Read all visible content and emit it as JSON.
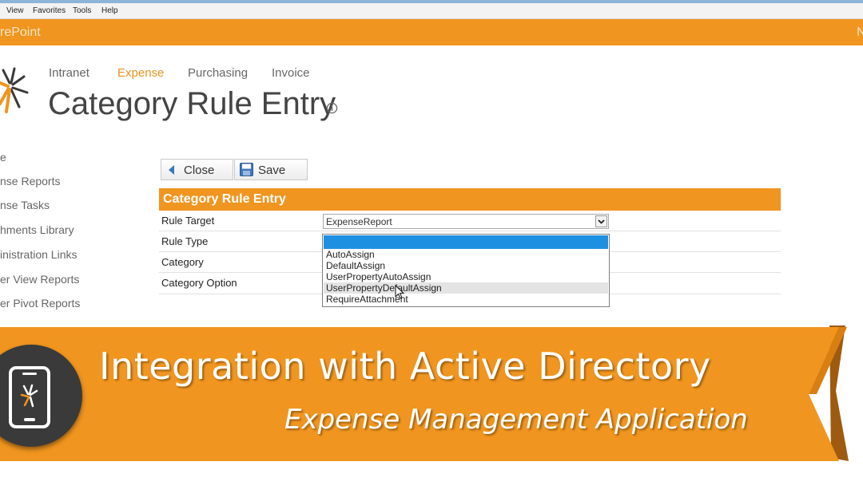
{
  "browser_menu": [
    "View",
    "Favorites",
    "Tools",
    "Help"
  ],
  "suite_bar": {
    "brand": "rePoint",
    "right_text": "N"
  },
  "top_nav": [
    {
      "label": "Intranet",
      "active": false
    },
    {
      "label": "Expense",
      "active": true
    },
    {
      "label": "Purchasing",
      "active": false
    },
    {
      "label": "Invoice",
      "active": false
    }
  ],
  "page": {
    "title": "Category Rule Entry",
    "info_icon": "info-circle-icon"
  },
  "left_nav": [
    "e",
    "nse Reports",
    "nse Tasks",
    "hments Library",
    "inistration Links",
    "er View Reports",
    "er Pivot Reports"
  ],
  "toolbar": {
    "close_label": "Close",
    "save_label": "Save"
  },
  "form": {
    "header": "Category Rule Entry",
    "rows": [
      {
        "label": "Rule Target"
      },
      {
        "label": "Rule Type"
      },
      {
        "label": "Category"
      },
      {
        "label": "Category Option"
      }
    ],
    "rule_target_value": "ExpenseReport",
    "rule_type_selected": "",
    "rule_type_options": [
      "AutoAssign",
      "DefaultAssign",
      "UserPropertyAutoAssign",
      "UserPropertyDefaultAssign",
      "RequireAttachment"
    ],
    "hovered_option": "UserPropertyDefaultAssign"
  },
  "banner": {
    "title": "Integration with Active Directory",
    "subtitle": "Expense Management Application",
    "icon": "mobile-phone-icon"
  },
  "colors": {
    "accent_orange": "#f0951f",
    "active_nav": "#e8921f",
    "selection_blue": "#1e90e2",
    "banner_dark": "#3a3a3a"
  }
}
